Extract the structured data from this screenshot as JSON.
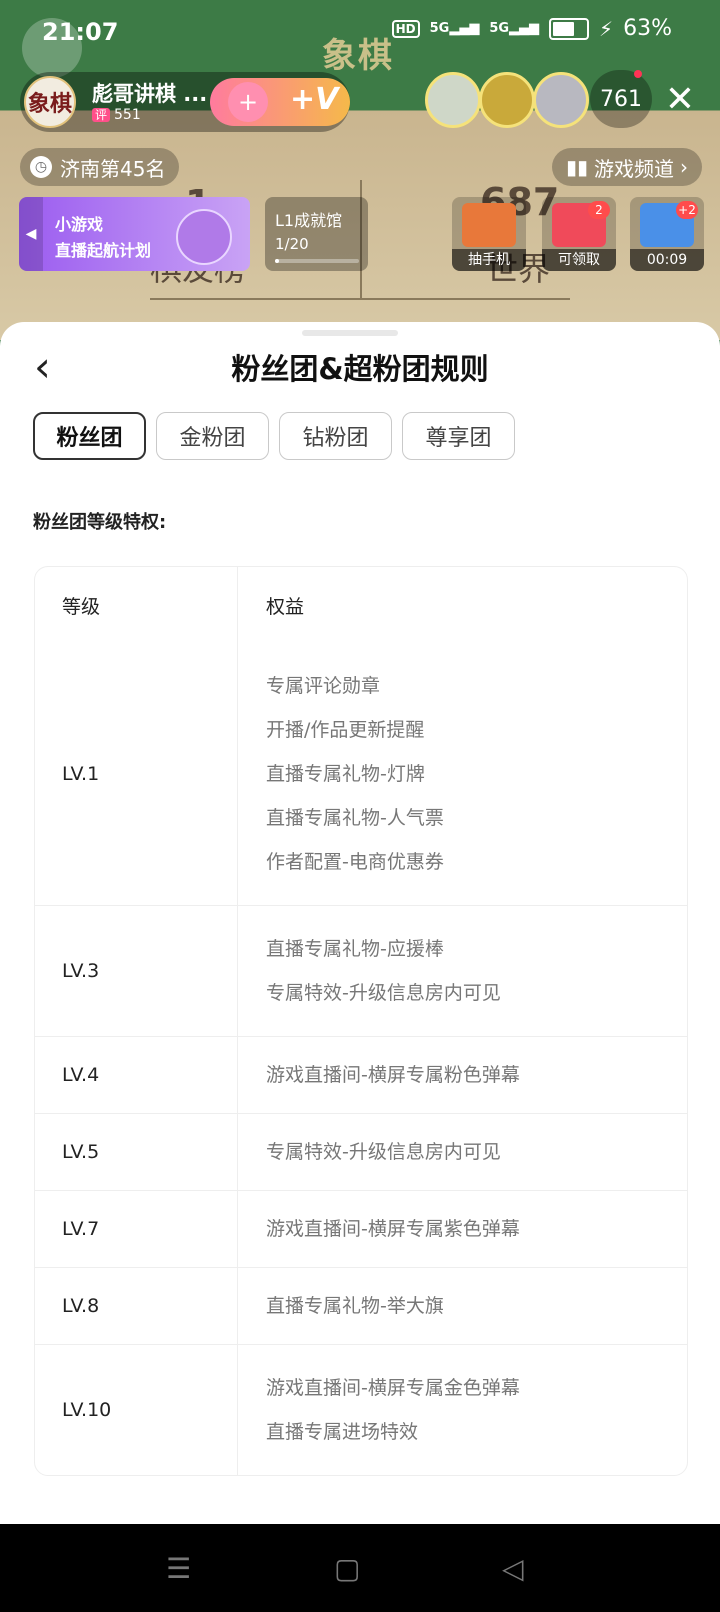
{
  "status_bar": {
    "time": "21:07",
    "hd": "HD",
    "sig1": "5G",
    "sig2": "5G",
    "battery": "63%"
  },
  "scene": {
    "board_title": "象棋",
    "ghost_rank": "1",
    "ghost_rank_label": "棋友榜",
    "ghost_world_num": "687",
    "ghost_world_label": "世界"
  },
  "host": {
    "name": "彪哥讲棋 ...",
    "score_tag": "评",
    "score": "551",
    "avatar_text": "象棋",
    "fav_plus": "+",
    "fav_v": "+V"
  },
  "viewer_count": "761",
  "rank_label": "济南第45名",
  "channel_label": "游戏频道",
  "promo": {
    "line1": "小游戏",
    "line2": "直播起航计划"
  },
  "achievement": {
    "title": "L1成就馆",
    "progress_text": "1/20",
    "progress_fraction": 0.05
  },
  "tasks": [
    {
      "label": "抽手机",
      "badge": ""
    },
    {
      "label": "可领取",
      "badge": "2"
    },
    {
      "label": "00:09",
      "badge": "+2"
    }
  ],
  "sheet": {
    "title": "粉丝团&超粉团规则",
    "tabs": [
      "粉丝团",
      "金粉团",
      "钻粉团",
      "尊享团"
    ],
    "section_title": "粉丝团等级特权:",
    "table_headers": [
      "等级",
      "权益"
    ],
    "rows": [
      {
        "level": "LV.1",
        "benefits": [
          "专属评论勋章",
          "开播/作品更新提醒",
          "直播专属礼物-灯牌",
          "直播专属礼物-人气票",
          "作者配置-电商优惠券"
        ]
      },
      {
        "level": "LV.3",
        "benefits": [
          "直播专属礼物-应援棒",
          "专属特效-升级信息房内可见"
        ]
      },
      {
        "level": "LV.4",
        "benefits": [
          "游戏直播间-横屏专属粉色弹幕"
        ]
      },
      {
        "level": "LV.5",
        "benefits": [
          "专属特效-升级信息房内可见"
        ]
      },
      {
        "level": "LV.7",
        "benefits": [
          "游戏直播间-横屏专属紫色弹幕"
        ]
      },
      {
        "level": "LV.8",
        "benefits": [
          "直播专属礼物-举大旗"
        ]
      },
      {
        "level": "LV.10",
        "benefits": [
          "游戏直播间-横屏专属金色弹幕",
          "直播专属进场特效"
        ]
      }
    ]
  },
  "colors": {
    "accent": "#9b5cf0",
    "scene_green": "#3d7b46"
  }
}
